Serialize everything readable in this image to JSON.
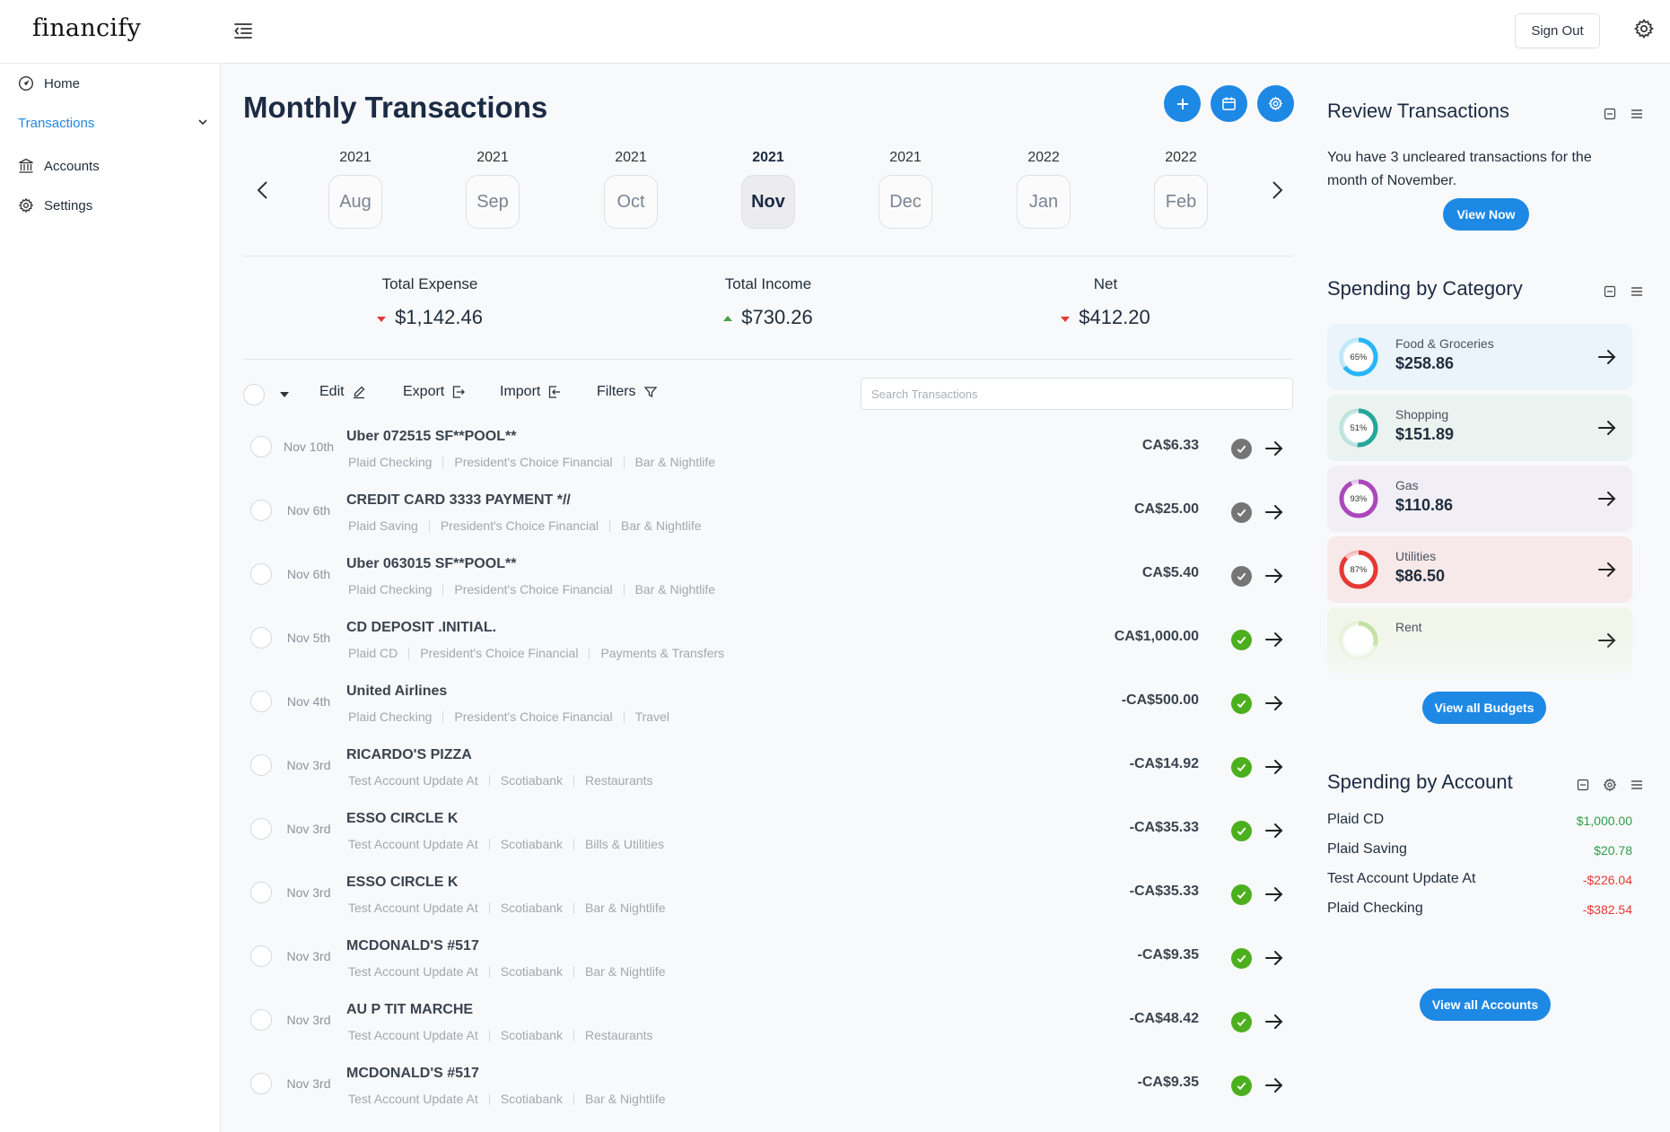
{
  "app": {
    "logo": "financify",
    "sign_out": "Sign Out"
  },
  "sidebar": {
    "items": [
      {
        "label": "Home",
        "icon": "dashboard-icon"
      },
      {
        "label": "Transactions",
        "icon": "chevron-down-icon"
      },
      {
        "label": "Accounts",
        "icon": "bank-icon"
      },
      {
        "label": "Settings",
        "icon": "gear-icon"
      }
    ]
  },
  "main": {
    "title": "Monthly Transactions",
    "months": [
      {
        "year": "2021",
        "month": "Aug"
      },
      {
        "year": "2021",
        "month": "Sep"
      },
      {
        "year": "2021",
        "month": "Oct"
      },
      {
        "year": "2021",
        "month": "Nov",
        "selected": true
      },
      {
        "year": "2021",
        "month": "Dec"
      },
      {
        "year": "2022",
        "month": "Jan"
      },
      {
        "year": "2022",
        "month": "Feb"
      }
    ],
    "summary": {
      "expense_label": "Total Expense",
      "expense_value": "$1,142.46",
      "income_label": "Total Income",
      "income_value": "$730.26",
      "net_label": "Net",
      "net_value": "$412.20"
    },
    "toolbar": {
      "edit": "Edit",
      "export": "Export",
      "import": "Import",
      "filters": "Filters",
      "search_placeholder": "Search Transactions"
    },
    "transactions": [
      {
        "date": "Nov 10th",
        "name": "Uber 072515 SF**POOL**",
        "account": "Plaid Checking",
        "institution": "President's Choice Financial",
        "category": "Bar & Nightlife",
        "amount": "CA$6.33",
        "status": "uncleared"
      },
      {
        "date": "Nov 6th",
        "name": "CREDIT CARD 3333 PAYMENT *//",
        "account": "Plaid Saving",
        "institution": "President's Choice Financial",
        "category": "Bar & Nightlife",
        "amount": "CA$25.00",
        "status": "uncleared"
      },
      {
        "date": "Nov 6th",
        "name": "Uber 063015 SF**POOL**",
        "account": "Plaid Checking",
        "institution": "President's Choice Financial",
        "category": "Bar & Nightlife",
        "amount": "CA$5.40",
        "status": "uncleared"
      },
      {
        "date": "Nov 5th",
        "name": "CD DEPOSIT .INITIAL.",
        "account": "Plaid CD",
        "institution": "President's Choice Financial",
        "category": "Payments & Transfers",
        "amount": "CA$1,000.00",
        "status": "cleared"
      },
      {
        "date": "Nov 4th",
        "name": "United Airlines",
        "account": "Plaid Checking",
        "institution": "President's Choice Financial",
        "category": "Travel",
        "amount": "-CA$500.00",
        "status": "cleared"
      },
      {
        "date": "Nov 3rd",
        "name": "RICARDO'S PIZZA",
        "account": "Test Account Update At",
        "institution": "Scotiabank",
        "category": "Restaurants",
        "amount": "-CA$14.92",
        "status": "cleared"
      },
      {
        "date": "Nov 3rd",
        "name": "ESSO CIRCLE K",
        "account": "Test Account Update At",
        "institution": "Scotiabank",
        "category": "Bills & Utilities",
        "amount": "-CA$35.33",
        "status": "cleared"
      },
      {
        "date": "Nov 3rd",
        "name": "ESSO CIRCLE K",
        "account": "Test Account Update At",
        "institution": "Scotiabank",
        "category": "Bar & Nightlife",
        "amount": "-CA$35.33",
        "status": "cleared"
      },
      {
        "date": "Nov 3rd",
        "name": "MCDONALD'S #517",
        "account": "Test Account Update At",
        "institution": "Scotiabank",
        "category": "Bar & Nightlife",
        "amount": "-CA$9.35",
        "status": "cleared"
      },
      {
        "date": "Nov 3rd",
        "name": "AU P TIT MARCHE",
        "account": "Test Account Update At",
        "institution": "Scotiabank",
        "category": "Restaurants",
        "amount": "-CA$48.42",
        "status": "cleared"
      },
      {
        "date": "Nov 3rd",
        "name": "MCDONALD'S #517",
        "account": "Test Account Update At",
        "institution": "Scotiabank",
        "category": "Bar & Nightlife",
        "amount": "-CA$9.35",
        "status": "cleared"
      }
    ]
  },
  "review": {
    "title": "Review Transactions",
    "text": "You have 3 uncleared transactions for the month of November.",
    "button": "View Now"
  },
  "categories": {
    "title": "Spending by Category",
    "items": [
      {
        "name": "Food & Groceries",
        "amount": "$258.86",
        "percent_label": "65%",
        "percent": 65,
        "color": "#29b6f6",
        "bg": "#eaf4fa"
      },
      {
        "name": "Shopping",
        "amount": "$151.89",
        "percent_label": "51%",
        "percent": 51,
        "color": "#26a69a",
        "bg": "#ebf3f0"
      },
      {
        "name": "Gas",
        "amount": "$110.86",
        "percent_label": "93%",
        "percent": 93,
        "color": "#ab47bc",
        "bg": "#f1eef6"
      },
      {
        "name": "Utilities",
        "amount": "$86.50",
        "percent_label": "87%",
        "percent": 87,
        "color": "#e53935",
        "bg": "#f7e9e9"
      },
      {
        "name": "Rent",
        "amount": "",
        "percent_label": "",
        "percent": 30,
        "color": "#c5e1a5",
        "bg": "#f2f6ea"
      }
    ],
    "button": "View all Budgets"
  },
  "accounts": {
    "title": "Spending by Account",
    "items": [
      {
        "name": "Plaid CD",
        "value": "$1,000.00",
        "sign": "pos"
      },
      {
        "name": "Plaid Saving",
        "value": "$20.78",
        "sign": "pos"
      },
      {
        "name": "Test Account Update At",
        "value": "-$226.04",
        "sign": "neg"
      },
      {
        "name": "Plaid Checking",
        "value": "-$382.54",
        "sign": "neg"
      }
    ],
    "button": "View all Accounts"
  },
  "colors": {
    "accent": "#1e88e5",
    "cleared": "#4caf1e",
    "uncleared": "#757575",
    "negative": "#e53935",
    "positive": "#2e9e4e"
  }
}
